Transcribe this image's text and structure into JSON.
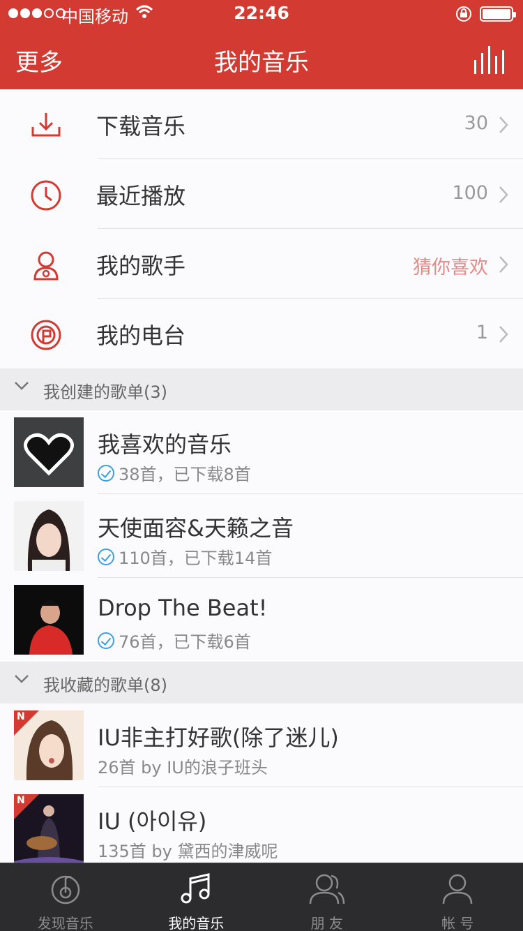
{
  "status": {
    "carrier": "中国移动",
    "time": "22:46"
  },
  "nav": {
    "left": "更多",
    "title": "我的音乐"
  },
  "menu": [
    {
      "label": "下载音乐",
      "value": "30",
      "icon": "download-icon"
    },
    {
      "label": "最近播放",
      "value": "100",
      "icon": "clock-icon"
    },
    {
      "label": "我的歌手",
      "value": "猜你喜欢",
      "icon": "singer-icon",
      "value_color": "#e38a87"
    },
    {
      "label": "我的电台",
      "value": "1",
      "icon": "radio-icon"
    }
  ],
  "created": {
    "header": "我创建的歌单(3)",
    "items": [
      {
        "name": "我喜欢的音乐",
        "info": "38首，已下载8首"
      },
      {
        "name": "天使面容&天籁之音",
        "info": "110首，已下载14首"
      },
      {
        "name": "Drop The Beat!",
        "info": "76首，已下载6首"
      }
    ]
  },
  "collected": {
    "header": "我收藏的歌单(8)",
    "items": [
      {
        "name": "IU非主打好歌(除了迷儿)",
        "info": "26首  by IU的浪子班头"
      },
      {
        "name": "IU (아이유)",
        "info": "135首  by 黛西的津威呢"
      }
    ]
  },
  "tabs": [
    {
      "label": "发现音乐",
      "icon": "discover-icon"
    },
    {
      "label": "我的音乐",
      "icon": "music-note-icon",
      "active": true
    },
    {
      "label": "朋 友",
      "icon": "friends-icon"
    },
    {
      "label": "帐 号",
      "icon": "account-icon"
    }
  ],
  "colors": {
    "brand": "#d33a31",
    "tabbar": "#2c2c2e",
    "check": "#3aa0e0"
  }
}
